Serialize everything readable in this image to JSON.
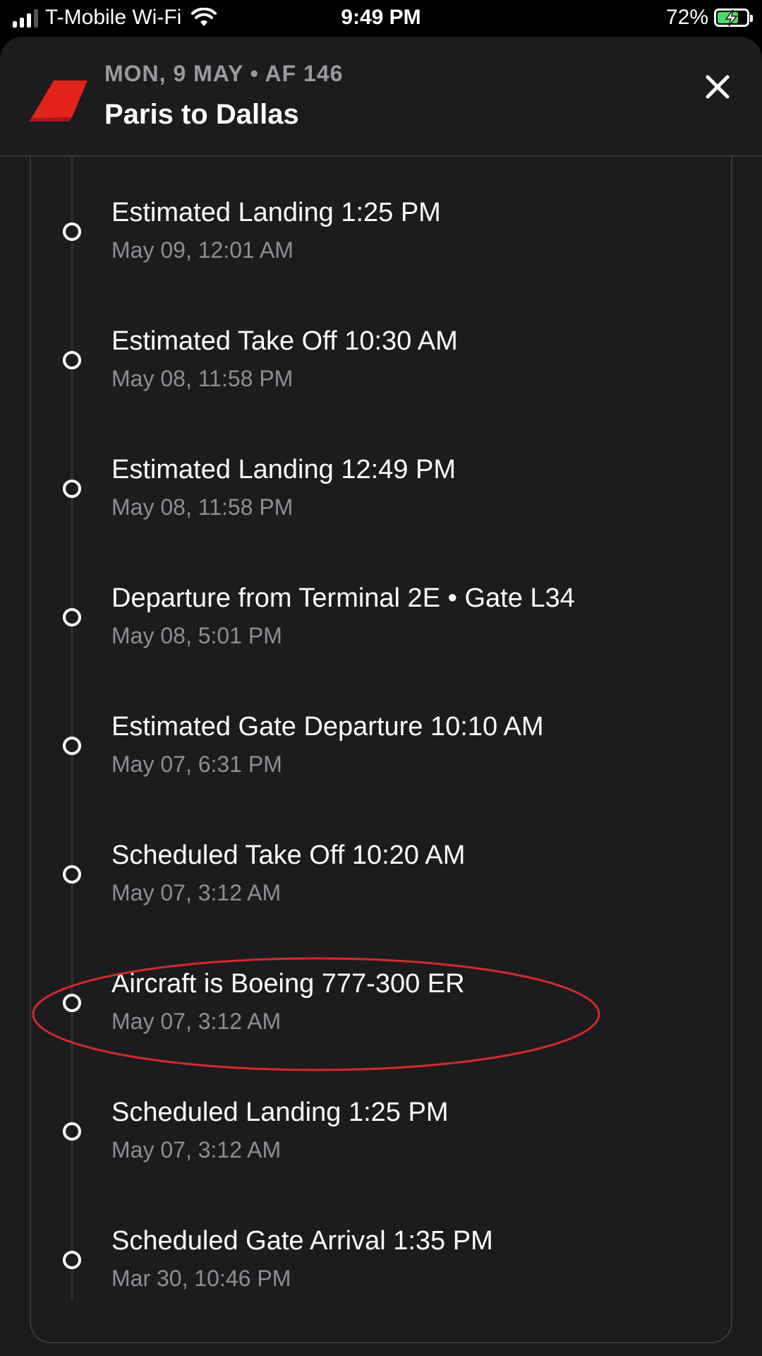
{
  "status_bar": {
    "carrier": "T-Mobile Wi-Fi",
    "time": "9:49 PM",
    "battery_percent": "72%",
    "battery_level": 0.72,
    "battery_color": "#4cd964"
  },
  "header": {
    "subtitle": "MON, 9 MAY • AF 146",
    "title": "Paris to Dallas",
    "logo_color": "#e2231a",
    "close_icon": "close-icon"
  },
  "events": [
    {
      "title": "Estimated Landing 1:25 PM",
      "time": "May 09, 12:01 AM"
    },
    {
      "title": "Estimated Take Off 10:30 AM",
      "time": "May 08, 11:58 PM"
    },
    {
      "title": "Estimated Landing 12:49 PM",
      "time": "May 08, 11:58 PM"
    },
    {
      "title": "Departure from Terminal 2E • Gate L34",
      "time": "May 08, 5:01 PM"
    },
    {
      "title": "Estimated Gate Departure 10:10 AM",
      "time": "May 07, 6:31 PM"
    },
    {
      "title": "Scheduled Take Off 10:20 AM",
      "time": "May 07, 3:12 AM"
    },
    {
      "title": "Aircraft is Boeing 777-300 ER",
      "time": "May 07, 3:12 AM"
    },
    {
      "title": "Scheduled Landing 1:25 PM",
      "time": "May 07, 3:12 AM"
    },
    {
      "title": "Scheduled Gate Arrival 1:35 PM",
      "time": "Mar 30, 10:46 PM"
    }
  ],
  "annotation": {
    "highlight_color": "#d42a2a"
  }
}
